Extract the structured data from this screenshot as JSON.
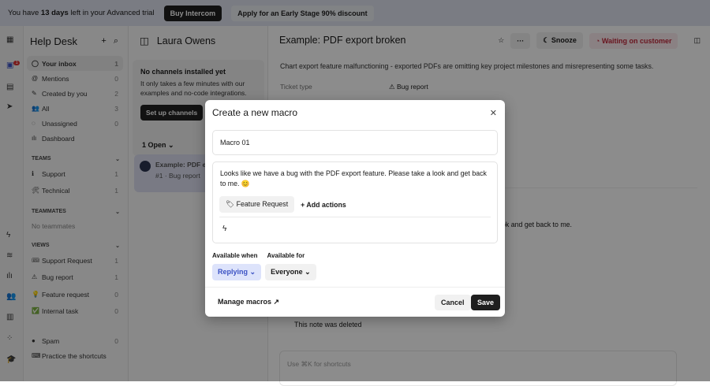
{
  "banner": {
    "text_pre": "You have ",
    "days": "13 days",
    "text_post": " left in your Advanced trial",
    "buy": "Buy Intercom",
    "apply": "Apply for an Early Stage 90% discount"
  },
  "rail": {
    "badge": "1"
  },
  "sidebar": {
    "title": "Help Desk",
    "items": [
      {
        "label": "Your inbox",
        "count": "1",
        "icon": "avatar"
      },
      {
        "label": "Mentions",
        "count": "0",
        "icon": "@"
      },
      {
        "label": "Created by you",
        "count": "2",
        "icon": "✎"
      },
      {
        "label": "All",
        "count": "3",
        "icon": "👥"
      },
      {
        "label": "Unassigned",
        "count": "0",
        "icon": "◌"
      },
      {
        "label": "Dashboard",
        "count": "",
        "icon": "ılı"
      }
    ],
    "teams_header": "TEAMS",
    "teams": [
      {
        "label": "Support",
        "count": "1",
        "icon": "ℹ"
      },
      {
        "label": "Technical",
        "count": "1",
        "icon": "🛠"
      }
    ],
    "teammates_header": "TEAMMATES",
    "no_teammates": "No teammates",
    "views_header": "VIEWS",
    "views": [
      {
        "label": "Support Request",
        "count": "1",
        "icon": "🎟"
      },
      {
        "label": "Bug report",
        "count": "1",
        "icon": "⚠"
      },
      {
        "label": "Feature request",
        "count": "0",
        "icon": "💡"
      },
      {
        "label": "Internal task",
        "count": "0",
        "icon": "✅"
      }
    ],
    "spam": {
      "label": "Spam",
      "count": "0"
    },
    "practice": "Practice the shortcuts"
  },
  "list": {
    "title": "Laura Owens",
    "card_title": "No channels installed yet",
    "card_text": "It only takes a few minutes with our examples and no-code integrations.",
    "card_button": "Set up channels",
    "open_filter": "1 Open",
    "conv_title": "Example: PDF exp",
    "conv_sub": "#1 · Bug report"
  },
  "ticket": {
    "title": "Example: PDF export broken",
    "snooze": "Snooze",
    "status": "Waiting on customer",
    "description": "Chart export feature malfunctioning - exported PDFs are omitting key project milestones and misrepresenting some tasks.",
    "type_label": "Ticket type",
    "type_value": "Bug report",
    "message_tail": "ok and get back to me.",
    "deleted_note": "This note was deleted",
    "composer_placeholder": "Use ⌘K for shortcuts"
  },
  "modal": {
    "title": "Create a new macro",
    "name": "Macro 01",
    "body": "Looks like we have a bug with the PDF export feature. Please take a look and get back to me. 😊",
    "tag": "Feature Request",
    "add_actions": "+ Add actions",
    "available_when_label": "Available when",
    "available_for_label": "Available for",
    "available_when": "Replying",
    "available_for": "Everyone",
    "manage": "Manage macros ↗",
    "cancel": "Cancel",
    "save": "Save"
  }
}
